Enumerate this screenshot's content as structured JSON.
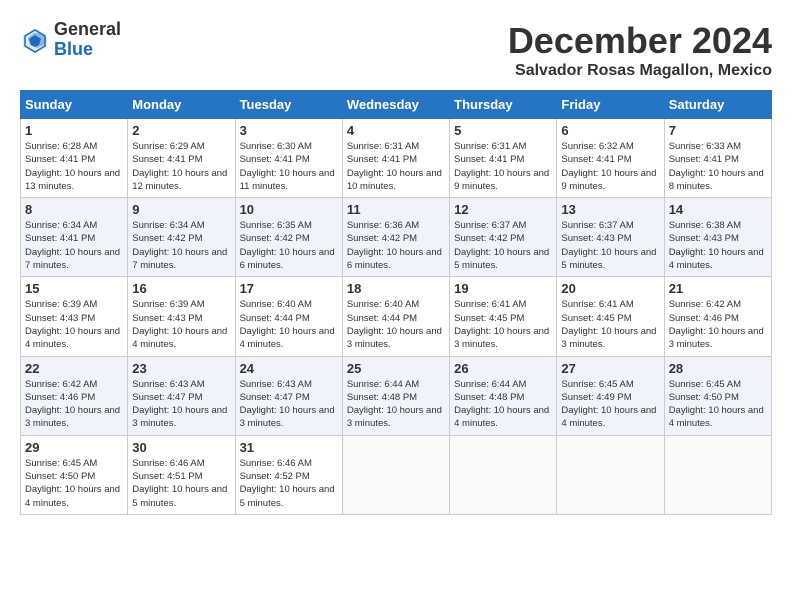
{
  "header": {
    "logo": {
      "general": "General",
      "blue": "Blue"
    },
    "title": "December 2024",
    "subtitle": "Salvador Rosas Magallon, Mexico"
  },
  "calendar": {
    "days_of_week": [
      "Sunday",
      "Monday",
      "Tuesday",
      "Wednesday",
      "Thursday",
      "Friday",
      "Saturday"
    ],
    "weeks": [
      [
        null,
        {
          "day": 2,
          "sunrise": "6:29 AM",
          "sunset": "4:41 PM",
          "daylight": "10 hours and 12 minutes."
        },
        {
          "day": 3,
          "sunrise": "6:30 AM",
          "sunset": "4:41 PM",
          "daylight": "10 hours and 11 minutes."
        },
        {
          "day": 4,
          "sunrise": "6:31 AM",
          "sunset": "4:41 PM",
          "daylight": "10 hours and 10 minutes."
        },
        {
          "day": 5,
          "sunrise": "6:31 AM",
          "sunset": "4:41 PM",
          "daylight": "10 hours and 9 minutes."
        },
        {
          "day": 6,
          "sunrise": "6:32 AM",
          "sunset": "4:41 PM",
          "daylight": "10 hours and 9 minutes."
        },
        {
          "day": 7,
          "sunrise": "6:33 AM",
          "sunset": "4:41 PM",
          "daylight": "10 hours and 8 minutes."
        }
      ],
      [
        {
          "day": 1,
          "sunrise": "6:28 AM",
          "sunset": "4:41 PM",
          "daylight": "10 hours and 13 minutes."
        },
        {
          "day": 9,
          "sunrise": "6:34 AM",
          "sunset": "4:42 PM",
          "daylight": "10 hours and 7 minutes."
        },
        {
          "day": 10,
          "sunrise": "6:35 AM",
          "sunset": "4:42 PM",
          "daylight": "10 hours and 6 minutes."
        },
        {
          "day": 11,
          "sunrise": "6:36 AM",
          "sunset": "4:42 PM",
          "daylight": "10 hours and 6 minutes."
        },
        {
          "day": 12,
          "sunrise": "6:37 AM",
          "sunset": "4:42 PM",
          "daylight": "10 hours and 5 minutes."
        },
        {
          "day": 13,
          "sunrise": "6:37 AM",
          "sunset": "4:43 PM",
          "daylight": "10 hours and 5 minutes."
        },
        {
          "day": 14,
          "sunrise": "6:38 AM",
          "sunset": "4:43 PM",
          "daylight": "10 hours and 4 minutes."
        }
      ],
      [
        {
          "day": 8,
          "sunrise": "6:34 AM",
          "sunset": "4:41 PM",
          "daylight": "10 hours and 7 minutes."
        },
        {
          "day": 16,
          "sunrise": "6:39 AM",
          "sunset": "4:43 PM",
          "daylight": "10 hours and 4 minutes."
        },
        {
          "day": 17,
          "sunrise": "6:40 AM",
          "sunset": "4:44 PM",
          "daylight": "10 hours and 4 minutes."
        },
        {
          "day": 18,
          "sunrise": "6:40 AM",
          "sunset": "4:44 PM",
          "daylight": "10 hours and 3 minutes."
        },
        {
          "day": 19,
          "sunrise": "6:41 AM",
          "sunset": "4:45 PM",
          "daylight": "10 hours and 3 minutes."
        },
        {
          "day": 20,
          "sunrise": "6:41 AM",
          "sunset": "4:45 PM",
          "daylight": "10 hours and 3 minutes."
        },
        {
          "day": 21,
          "sunrise": "6:42 AM",
          "sunset": "4:46 PM",
          "daylight": "10 hours and 3 minutes."
        }
      ],
      [
        {
          "day": 15,
          "sunrise": "6:39 AM",
          "sunset": "4:43 PM",
          "daylight": "10 hours and 4 minutes."
        },
        {
          "day": 23,
          "sunrise": "6:43 AM",
          "sunset": "4:47 PM",
          "daylight": "10 hours and 3 minutes."
        },
        {
          "day": 24,
          "sunrise": "6:43 AM",
          "sunset": "4:47 PM",
          "daylight": "10 hours and 3 minutes."
        },
        {
          "day": 25,
          "sunrise": "6:44 AM",
          "sunset": "4:48 PM",
          "daylight": "10 hours and 3 minutes."
        },
        {
          "day": 26,
          "sunrise": "6:44 AM",
          "sunset": "4:48 PM",
          "daylight": "10 hours and 4 minutes."
        },
        {
          "day": 27,
          "sunrise": "6:45 AM",
          "sunset": "4:49 PM",
          "daylight": "10 hours and 4 minutes."
        },
        {
          "day": 28,
          "sunrise": "6:45 AM",
          "sunset": "4:50 PM",
          "daylight": "10 hours and 4 minutes."
        }
      ],
      [
        {
          "day": 22,
          "sunrise": "6:42 AM",
          "sunset": "4:46 PM",
          "daylight": "10 hours and 3 minutes."
        },
        {
          "day": 30,
          "sunrise": "6:46 AM",
          "sunset": "4:51 PM",
          "daylight": "10 hours and 5 minutes."
        },
        {
          "day": 31,
          "sunrise": "6:46 AM",
          "sunset": "4:52 PM",
          "daylight": "10 hours and 5 minutes."
        },
        null,
        null,
        null,
        null
      ],
      [
        {
          "day": 29,
          "sunrise": "6:45 AM",
          "sunset": "4:50 PM",
          "daylight": "10 hours and 4 minutes."
        },
        null,
        null,
        null,
        null,
        null,
        null
      ]
    ]
  }
}
